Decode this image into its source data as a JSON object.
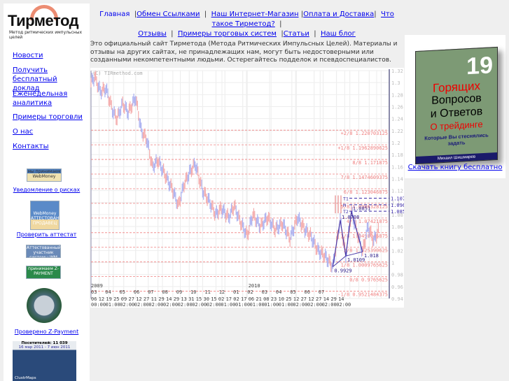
{
  "logo": {
    "name": "Тирметод",
    "tagline": "Метод ритмических импульсных целей"
  },
  "nav": {
    "row1": [
      "Главная",
      "Обмен Ссылками",
      "Наш Интернет-Магазин",
      "Оплата и Доставка",
      "Что такое Тирметод?"
    ],
    "row2": [
      "Отзывы",
      "Примеры торговых систем",
      "Статьи",
      "Наш блог"
    ]
  },
  "intro": "Это официальный сайт Тирметода (Метода Ритмических Импульсных Целей). Материалы и отзывы на других сайтах, не принадлежащих нам, могут быть недостоверными или созданными некомпетентными людьми. Остерегайтесь подделок и псевдоспециалистов.",
  "sidebar": {
    "items": [
      "Новости",
      "Получить бесплатный доклад",
      "Еженедельная аналитика",
      "Примеры торговли",
      "О нас",
      "Контакты"
    ],
    "links": {
      "risk": "Уведомление о рисках",
      "attest": "Проверить аттестат",
      "zpay": "Проверено Z-Payment"
    },
    "badges": {
      "wm": "мы принимаем WebMoney",
      "wmseller": "WebMoney АТТЕСТОВАННЫЙ ПРОДАВЕЦ",
      "wmmember": "Аттестованный участник системы WM",
      "zpayment": "принимаем Z-PAYMENT",
      "visitors": "Посетителей: 11 039",
      "visitors_dates": "16 мар 2011 - 7 июн 2011",
      "clustrmaps": "ClustrMaps"
    }
  },
  "right": {
    "book": {
      "number": "19",
      "l1": "Горящих",
      "l2": "Вопросов",
      "l3": "и Ответов",
      "l4": "О трейдинге",
      "l5": "Которые Вы стеснялись задать",
      "author": "Михаил Шишмарев"
    },
    "link": "Скачать книгу бесплатно"
  },
  "chart_data": {
    "type": "line",
    "watermark": "(C) TIRmethod.com",
    "ylim": [
      0.94,
      1.32
    ],
    "yticks": [
      "1.32",
      "1.3",
      "1.28",
      "1.26",
      "1.24",
      "1.22",
      "1.2",
      "1.18",
      "1.16",
      "1.14",
      "1.12",
      "1.1",
      "1.08",
      "1.06",
      "1.04",
      "1.02",
      "1",
      "0.98",
      "0.96",
      "0.94"
    ],
    "price": [
      [
        0,
        1.3
      ],
      [
        2,
        1.31
      ],
      [
        5,
        1.285
      ],
      [
        8,
        1.29
      ],
      [
        12,
        1.25
      ],
      [
        14,
        1.24
      ],
      [
        17,
        1.265
      ],
      [
        20,
        1.25
      ],
      [
        24,
        1.275
      ],
      [
        27,
        1.22
      ],
      [
        30,
        1.205
      ],
      [
        33,
        1.16
      ],
      [
        36,
        1.17
      ],
      [
        40,
        1.145
      ],
      [
        44,
        1.12
      ],
      [
        47,
        1.095
      ],
      [
        50,
        1.13
      ],
      [
        53,
        1.15
      ],
      [
        56,
        1.165
      ],
      [
        60,
        1.12
      ],
      [
        64,
        1.1
      ],
      [
        67,
        1.08
      ],
      [
        70,
        1.09
      ],
      [
        74,
        1.075
      ],
      [
        77,
        1.095
      ],
      [
        80,
        1.07
      ],
      [
        84,
        1.045
      ],
      [
        87,
        1.08
      ],
      [
        91,
        1.06
      ],
      [
        95,
        1.075
      ],
      [
        99,
        1.055
      ],
      [
        103,
        1.065
      ],
      [
        107,
        1.04
      ],
      [
        111,
        1.075
      ],
      [
        115,
        1.055
      ],
      [
        118,
        1.045
      ],
      [
        122,
        1.02
      ],
      [
        126,
        1.01
      ],
      [
        130,
        0.9929
      ],
      [
        134,
        1.0708
      ],
      [
        137,
        1.0109
      ],
      [
        140,
        1.0851
      ],
      [
        146,
        1.018
      ],
      [
        149,
        1.06
      ],
      [
        152,
        1.036
      ],
      [
        155,
        1.055
      ]
    ],
    "pivots": [
      {
        "x": 130,
        "y": 0.9929,
        "label": "0.9929"
      },
      {
        "x": 134,
        "y": 1.0708,
        "label": "1.0708"
      },
      {
        "x": 137,
        "y": 1.0109,
        "label": "1.0109"
      },
      {
        "x": 140,
        "y": 1.0851,
        "label": "1.0851"
      },
      {
        "x": 146,
        "y": 1.018,
        "label": "1.018"
      }
    ],
    "levels": [
      {
        "label": "+2/8 1.220703125",
        "value": 1.220703125
      },
      {
        "label": "+1/8 1.1962890625",
        "value": 1.1962890625
      },
      {
        "label": "8/8 1.171875",
        "value": 1.171875
      },
      {
        "label": "7/8 1.1474609375",
        "value": 1.1474609375
      },
      {
        "label": "6/8 1.123046875",
        "value": 1.123046875
      },
      {
        "label": "5/8 1.0986328125",
        "value": 1.0986328125
      },
      {
        "label": "4/8 1.07421875",
        "value": 1.07421875
      },
      {
        "label": "3/8 1.0498046875",
        "value": 1.0498046875
      },
      {
        "label": "2/8 1.025390625",
        "value": 1.025390625
      },
      {
        "label": "1/8 1.0009765625",
        "value": 1.0009765625
      },
      {
        "label": "0/8 0.9765625",
        "value": 0.9765625
      },
      {
        "label": "-1/8 0.9521484375",
        "value": 0.9521484375
      }
    ],
    "targets": [
      {
        "name": "T1",
        "value": 1.1073
      },
      {
        "name": "M",
        "value": 1.0964
      },
      {
        "name": "T2",
        "value": 1.0855
      }
    ],
    "xmax": 160,
    "years": [
      {
        "label": "2009",
        "i": 0
      },
      {
        "label": "2010",
        "i": 21
      }
    ],
    "months": [
      "03",
      "04",
      "05",
      "06",
      "07",
      "08",
      "09",
      "10",
      "11",
      "12",
      "01",
      "02",
      "03",
      "04",
      "05",
      "06",
      "07"
    ],
    "days": [
      "06",
      "12",
      "19",
      "25",
      "09",
      "27",
      "12",
      "27",
      "11",
      "29",
      "14",
      "29",
      "13",
      "31",
      "15",
      "30",
      "15",
      "02",
      "17",
      "02",
      "17",
      "06",
      "21",
      "08",
      "23",
      "10",
      "25",
      "12",
      "27",
      "12",
      "27",
      "14",
      "29",
      "14"
    ],
    "times": [
      "00:00",
      "01:00",
      "02:00",
      "02:00",
      "02:00",
      "02:00",
      "02:00",
      "02:00",
      "02:00",
      "01:00",
      "01:00",
      "01:00",
      "01:00",
      "01:00",
      "02:00",
      "02:00",
      "02:00",
      "02:00"
    ]
  }
}
